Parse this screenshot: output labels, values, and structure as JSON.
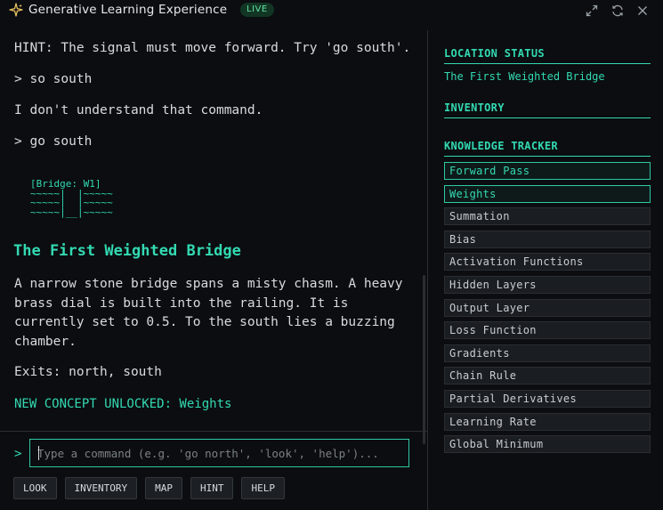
{
  "titlebar": {
    "title": "Generative Learning Experience",
    "badge": "LIVE",
    "icons": [
      "sparkle-icon",
      "expand-icon",
      "refresh-icon",
      "close-icon"
    ]
  },
  "log": {
    "hint": "HINT: The signal must move forward. Try 'go south'.",
    "cmd1": "> so south",
    "response1": "I don't understand that command.",
    "cmd2": "> go south",
    "ascii_art": "[Bridge: W1]\n~~~~~|  |~~~~~\n~~~~~|  |~~~~~\n~~~~~|__|~~~~~",
    "room_title": "The First Weighted Bridge",
    "room_desc": "A narrow stone bridge spans a misty chasm. A heavy brass dial is built into the railing. It is currently set to 0.5. To the south lies a buzzing chamber.",
    "exits": "Exits: north, south",
    "unlock": "NEW CONCEPT UNLOCKED: Weights"
  },
  "input": {
    "prompt": ">",
    "placeholder": "Type a command (e.g. 'go north', 'look', 'help')...",
    "value": ""
  },
  "buttons": [
    "LOOK",
    "INVENTORY",
    "MAP",
    "HINT",
    "HELP"
  ],
  "sidebar": {
    "location_title": "LOCATION STATUS",
    "location_value": "The First Weighted Bridge",
    "inventory_title": "INVENTORY",
    "knowledge_title": "KNOWLEDGE TRACKER",
    "concepts": [
      {
        "label": "Forward Pass",
        "unlocked": true
      },
      {
        "label": "Weights",
        "unlocked": true
      },
      {
        "label": "Summation",
        "unlocked": false
      },
      {
        "label": "Bias",
        "unlocked": false
      },
      {
        "label": "Activation Functions",
        "unlocked": false
      },
      {
        "label": "Hidden Layers",
        "unlocked": false
      },
      {
        "label": "Output Layer",
        "unlocked": false
      },
      {
        "label": "Loss Function",
        "unlocked": false
      },
      {
        "label": "Gradients",
        "unlocked": false
      },
      {
        "label": "Chain Rule",
        "unlocked": false
      },
      {
        "label": "Partial Derivatives",
        "unlocked": false
      },
      {
        "label": "Learning Rate",
        "unlocked": false
      },
      {
        "label": "Global Minimum",
        "unlocked": false
      }
    ]
  },
  "colors": {
    "accent": "#33d9b2",
    "background": "#0b0d10",
    "badge_bg": "#123524",
    "badge_text": "#5fe3a0"
  }
}
